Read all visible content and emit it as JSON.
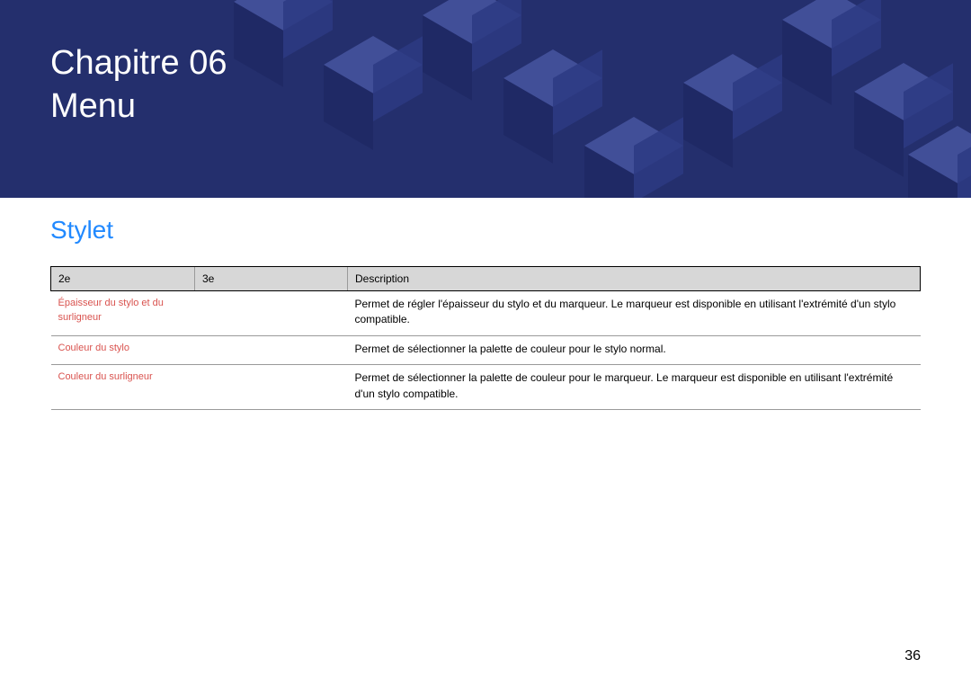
{
  "banner": {
    "chapter_label": "Chapitre 06",
    "chapter_title": "Menu"
  },
  "section": {
    "title": "Stylet"
  },
  "table": {
    "headers": {
      "col1": "2e",
      "col2": "3e",
      "col3": "Description"
    },
    "rows": [
      {
        "name": "Épaisseur du stylo et du surligneur",
        "sub": "",
        "desc": "Permet de régler l'épaisseur du stylo et du marqueur. Le marqueur est disponible en utilisant l'extrémité d'un stylo compatible."
      },
      {
        "name": "Couleur du stylo",
        "sub": "",
        "desc": "Permet de sélectionner la palette de couleur pour le stylo normal."
      },
      {
        "name": "Couleur du surligneur",
        "sub": "",
        "desc": "Permet de sélectionner la palette de couleur pour le marqueur. Le marqueur est disponible en utilisant l'extrémité d'un stylo compatible."
      }
    ]
  },
  "page_number": "36"
}
